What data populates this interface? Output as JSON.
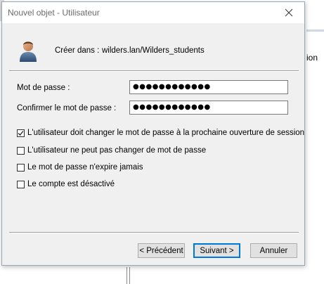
{
  "window": {
    "title": "Nouvel objet - Utilisateur"
  },
  "header": {
    "create_in_label": "Créer dans :",
    "create_in_path": "wilders.lan/Wilders_students"
  },
  "background": {
    "partial_text": "ion"
  },
  "password": {
    "label": "Mot de passe :",
    "value": "●●●●●●●●●●●●",
    "confirm_label": "Confirmer le mot de passe :",
    "confirm_value": "●●●●●●●●●●●●"
  },
  "options": [
    {
      "label": "L'utilisateur doit changer le mot de passe à la prochaine ouverture de session",
      "checked": true
    },
    {
      "label": "L'utilisateur ne peut pas changer de mot de passe",
      "checked": false
    },
    {
      "label": "Le mot de passe n'expire jamais",
      "checked": false
    },
    {
      "label": "Le compte est désactivé",
      "checked": false
    }
  ],
  "buttons": {
    "previous": "< Précédent",
    "next": "Suivant >",
    "cancel": "Annuler"
  },
  "colors": {
    "focus_border": "#0078d7",
    "dialog_bg": "#f0f0f0"
  }
}
